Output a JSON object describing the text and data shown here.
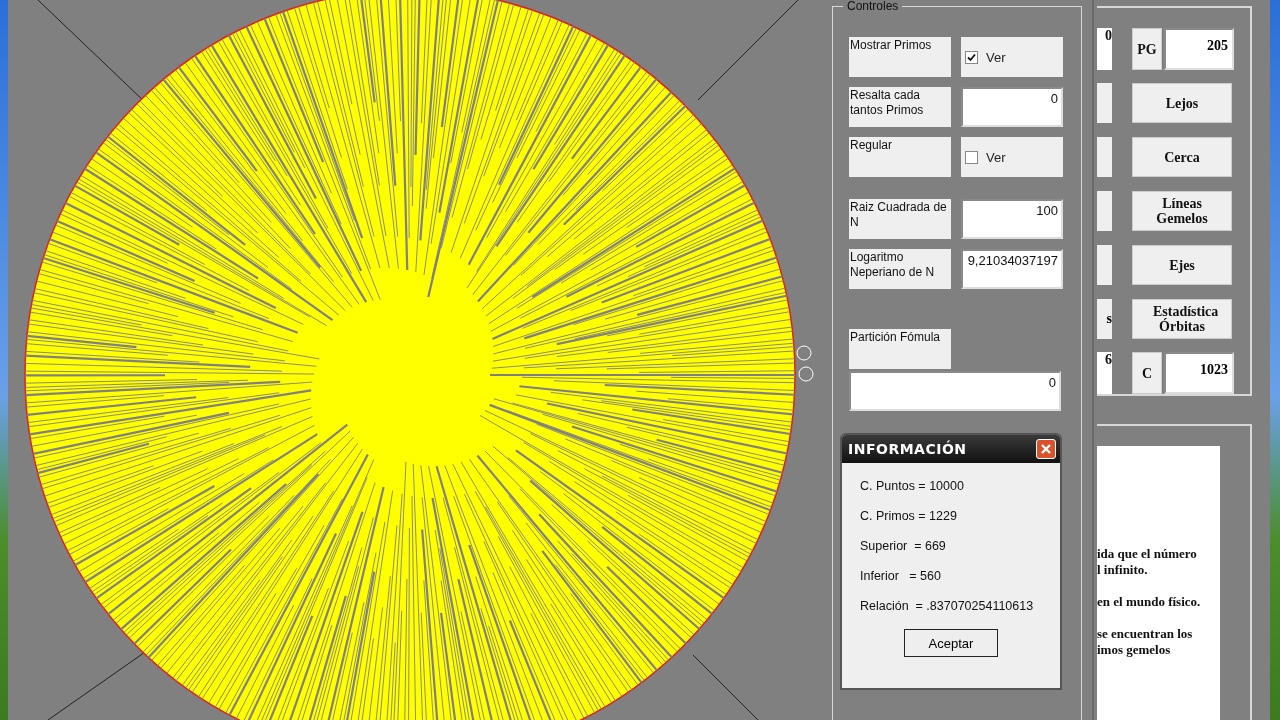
{
  "controls": {
    "title": "Controles",
    "rows": [
      {
        "kind": "checkbox",
        "label": "Mostrar Primos",
        "option": "Ver",
        "checked": true
      },
      {
        "kind": "field",
        "label": "Resalta cada tantos Primos",
        "value": "0"
      },
      {
        "kind": "checkbox",
        "label": "Regular",
        "option": "Ver",
        "checked": false
      },
      {
        "kind": "field",
        "label": "Raiz Cuadrada de N",
        "value": "100"
      },
      {
        "kind": "field",
        "label": "Logaritmo Neperiano de N",
        "value": "9,21034037197"
      }
    ],
    "partition": {
      "label": "Partición Fómula",
      "value": "0"
    }
  },
  "side_panel": {
    "rows": [
      {
        "kind": "labeled_field",
        "partial": "0",
        "label": "PG",
        "value": "205"
      },
      {
        "kind": "button",
        "label": "Lejos"
      },
      {
        "kind": "button",
        "label": "Cerca"
      },
      {
        "kind": "button",
        "label": "Líneas Gemelos"
      },
      {
        "kind": "button",
        "label": "Ejes"
      },
      {
        "kind": "button",
        "partial": "s",
        "label": "Estadística Órbitas"
      },
      {
        "kind": "labeled_field",
        "partial": "6",
        "label": "C",
        "value": "1023"
      }
    ],
    "notes": [
      "ida que el número",
      "l infinito.",
      "en el mundo físico.",
      "se encuentran los",
      "imos gemelos"
    ]
  },
  "info_dialog": {
    "title": "INFORMACIÓN",
    "lines": [
      "C. Puntos = 10000",
      "C. Primos = 1229",
      "Superior  = 669",
      "Inferior   = 560",
      "Relación  = .837070254110613"
    ],
    "button": "Aceptar"
  }
}
